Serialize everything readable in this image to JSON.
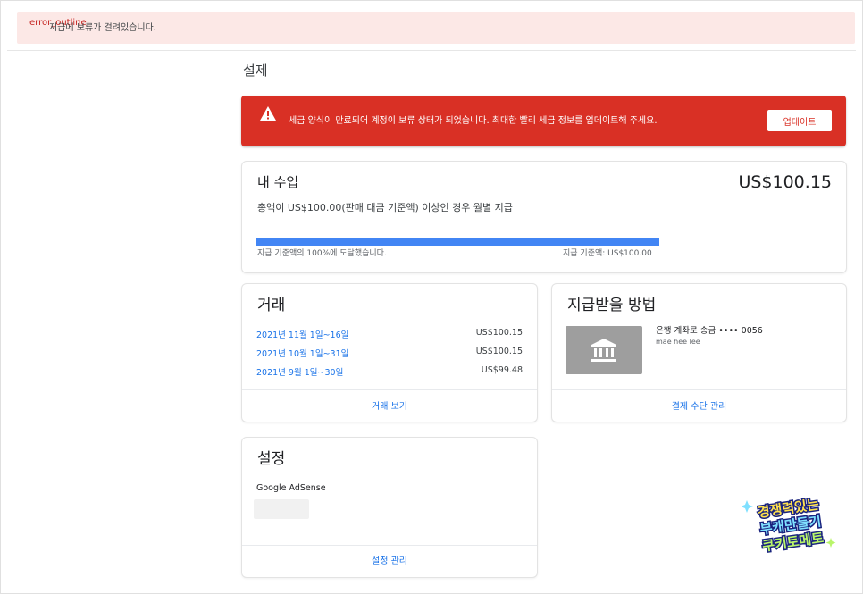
{
  "banner": {
    "overlay": "error_outline",
    "text": "지급에 보류가 걸려있습니다."
  },
  "page": {
    "title": "설제"
  },
  "alert": {
    "icon": "warning-icon",
    "message": "세금 양식이 만료되어 계정이 보류 상태가 되었습니다. 최대한 빨리 세금 정보를 업데이트해 주세요.",
    "button": "업데이트",
    "color": "#d93025"
  },
  "earnings": {
    "title": "내 수입",
    "amount": "US$100.15",
    "subtitle": "총액이 US$100.00(판매 대금 기준액) 이상인 경우 월별 지급",
    "progress": 1.0,
    "progress_left": "지급 기준액의 100%에 도달했습니다.",
    "progress_right": "지급 기준액: US$100.00",
    "bar_color": "#4285f4"
  },
  "transactions": {
    "title": "거래",
    "rows": [
      {
        "date": "2021년 11월 1일~16일",
        "value": "US$100.15"
      },
      {
        "date": "2021년 10월 1일~31일",
        "value": "US$100.15"
      },
      {
        "date": "2021년 9월 1일~30일",
        "value": "US$99.48"
      }
    ],
    "link": "거래 보기"
  },
  "payment": {
    "title": "지급받을 방법",
    "icon": "bank-icon",
    "method": "은행 계좌로 송금 •••• 0056",
    "holder": "mae hee lee",
    "link": "결제 수단 관리"
  },
  "settings": {
    "title": "설정",
    "item": "Google AdSense",
    "link": "설정 관리"
  },
  "watermark": {
    "lines": [
      "경쟁력있는",
      "부캐만들기",
      "쿠키토메토"
    ]
  }
}
